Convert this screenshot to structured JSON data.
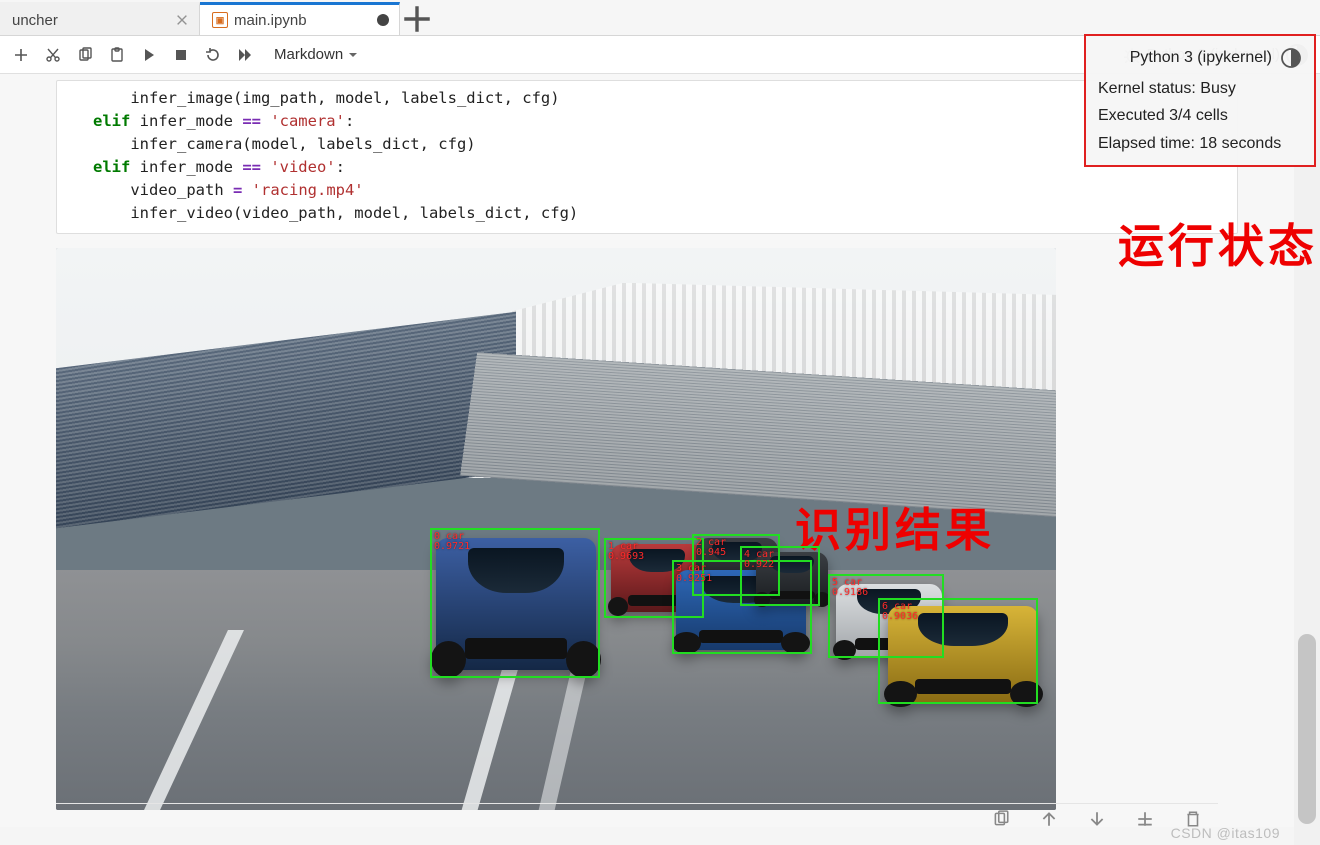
{
  "tabs": {
    "0": {
      "title": "uncher"
    },
    "1": {
      "title": "main.ipynb"
    }
  },
  "toolbar": {
    "celltype_label": "Markdown"
  },
  "kernel": {
    "name": "Python 3 (ipykernel)",
    "status": "Kernel status: Busy",
    "executed": "Executed 3/4 cells",
    "elapsed": "Elapsed time: 18 seconds"
  },
  "annotations": {
    "right": "运行状态",
    "result": "识别结果"
  },
  "code": {
    "l0a": "    infer_image(img_path, model, labels_dict, cfg)",
    "l1kw": "elif",
    "l1a": " infer_mode ",
    "l1op": "==",
    "l1s": " 'camera'",
    "l1b": ":",
    "l2a": "    infer_camera(model, labels_dict, cfg)",
    "l3kw": "elif",
    "l3a": " infer_mode ",
    "l3op": "==",
    "l3s": " 'video'",
    "l3b": ":",
    "l4a": "    video_path ",
    "l4op": "=",
    "l4s": " 'racing.mp4'",
    "l5a": "    infer_video(video_path, model, labels_dict, cfg)"
  },
  "detections": {
    "d0_label": "0 car\n0.9721",
    "d1_label": "1 car\n0.9693",
    "d2_label": "2 car\n0.945",
    "d3_label": "3 car\n0.9251",
    "d4_label": "4 car\n0.922",
    "d5_label": "5 car\n0.9186",
    "d6_label": "6 car\n0.9036"
  },
  "watermark": "CSDN @itas109"
}
